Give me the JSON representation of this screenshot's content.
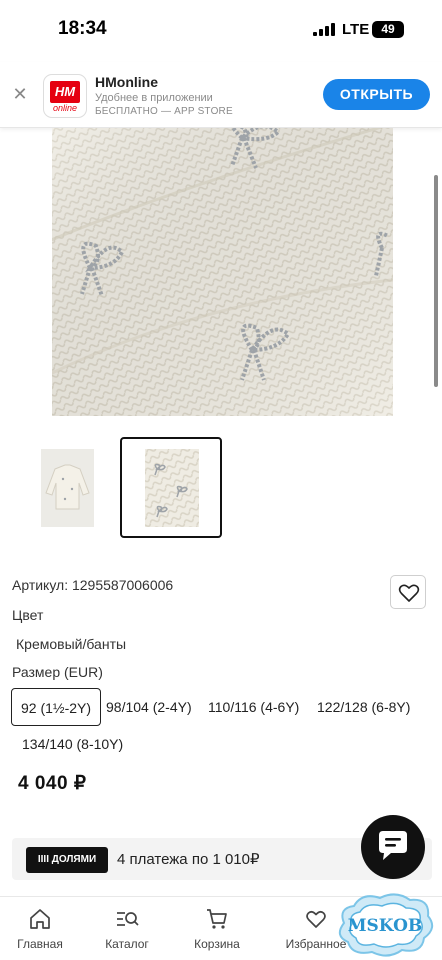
{
  "status_bar": {
    "time": "18:34",
    "network": "LTE",
    "battery": "49"
  },
  "app_banner": {
    "logo_text": "HM",
    "logo_sub": "online",
    "name": "HMonline",
    "subtitle": "Удобнее в приложении",
    "store": "БЕСПЛАТНО — APP STORE",
    "open_label": "ОТКРЫТЬ"
  },
  "product": {
    "article": "Артикул: 1295587006006",
    "color_label": "Цвет",
    "color_value": "Кремовый/банты",
    "size_label": "Размер (EUR)",
    "sizes": [
      "92 (1½-2Y)",
      "98/104 (2-4Y)",
      "110/116 (4-6Y)",
      "122/128 (6-8Y)",
      "134/140 (8-10Y)"
    ],
    "selected_size": "92 (1½-2Y)",
    "price": "4 040 ₽"
  },
  "installments": {
    "badge": "IIII ДОЛЯМИ",
    "text": "4 платежа по 1 010₽"
  },
  "bottom_nav": {
    "items": [
      {
        "label": "Главная",
        "icon": "home-icon"
      },
      {
        "label": "Каталог",
        "icon": "catalog-search-icon"
      },
      {
        "label": "Корзина",
        "icon": "cart-icon"
      },
      {
        "label": "Избранное",
        "icon": "heart-icon"
      }
    ]
  },
  "watermark": {
    "text": "MSKOB"
  },
  "colors": {
    "accent": "#1a84e8",
    "brand": "#e50010",
    "dark": "#111111"
  }
}
